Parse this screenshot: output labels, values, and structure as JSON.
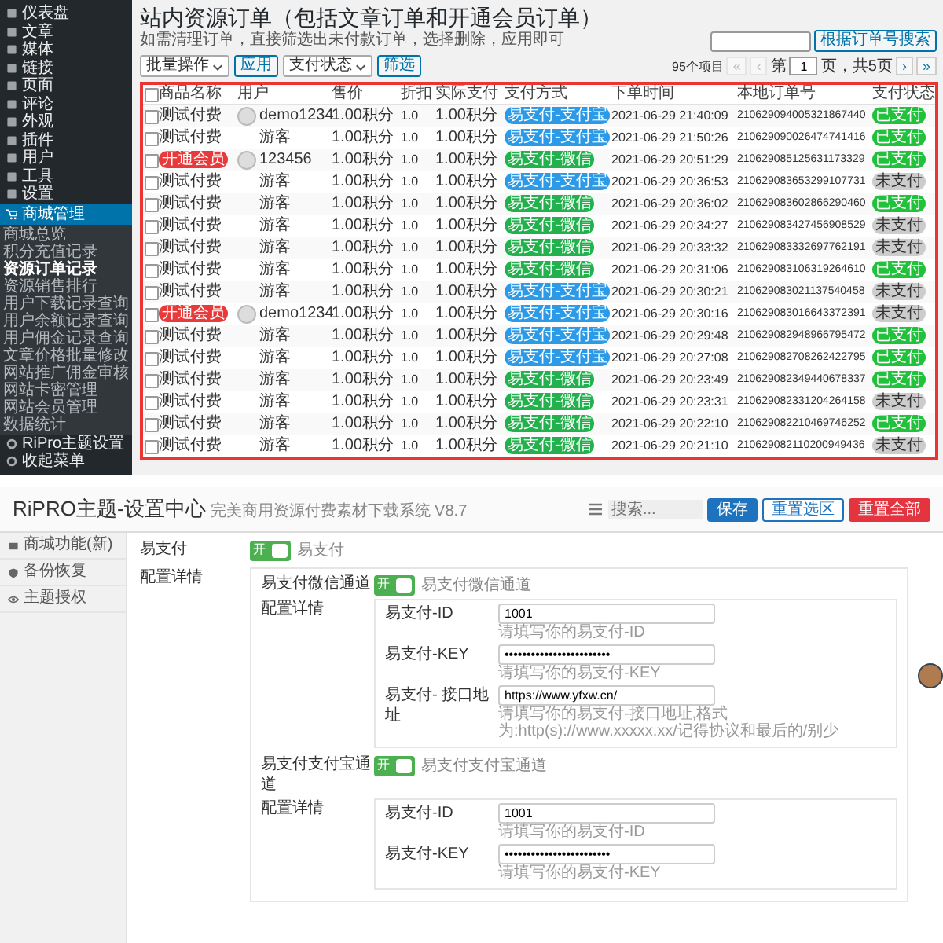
{
  "admin_sidebar": {
    "items": [
      {
        "label": "仪表盘",
        "selected": false
      },
      {
        "label": "文章",
        "selected": false
      },
      {
        "label": "媒体",
        "selected": false
      },
      {
        "label": "链接",
        "selected": false
      },
      {
        "label": "页面",
        "selected": false
      },
      {
        "label": "评论",
        "selected": false
      },
      {
        "label": "外观",
        "selected": false
      },
      {
        "label": "插件",
        "selected": false
      },
      {
        "label": "用户",
        "selected": false
      },
      {
        "label": "工具",
        "selected": false
      },
      {
        "label": "设置",
        "selected": false
      },
      {
        "label": "商城管理",
        "selected": true,
        "children": [
          {
            "label": "商城总览",
            "selected": false
          },
          {
            "label": "积分充值记录",
            "selected": false
          },
          {
            "label": "资源订单记录",
            "selected": true
          },
          {
            "label": "资源销售排行",
            "selected": false
          },
          {
            "label": "用户下载记录查询",
            "selected": false
          },
          {
            "label": "用户余额记录查询",
            "selected": false
          },
          {
            "label": "用户佣金记录查询",
            "selected": false
          },
          {
            "label": "文章价格批量修改",
            "selected": false
          },
          {
            "label": "网站推广佣金审核",
            "selected": false
          },
          {
            "label": "网站卡密管理",
            "selected": false
          },
          {
            "label": "网站会员管理",
            "selected": false
          },
          {
            "label": "数据统计",
            "selected": false
          }
        ]
      },
      {
        "label": "RiPro主题设置",
        "selected": false
      },
      {
        "label": "收起菜单",
        "selected": false
      }
    ]
  },
  "orders_page": {
    "title": "站内资源订单（包括文章订单和开通会员订单）",
    "subtitle": "如需清理订单，直接筛选出未付款订单，选择删除，应用即可",
    "bulk_action": "批量操作",
    "apply_button": "应用",
    "status_filter": "支付状态",
    "filter_button": "筛选",
    "search_button": "根据订单号搜索",
    "pagination": {
      "count": "95个项目",
      "page_prefix": "第",
      "page": "1",
      "page_suffix": "页，共5页",
      "nav": [
        {
          "label": "«",
          "disabled": true
        },
        {
          "label": "‹",
          "disabled": true
        },
        {
          "label": "›",
          "disabled": false
        },
        {
          "label": "»",
          "disabled": false
        }
      ]
    },
    "table": {
      "header_checked": false,
      "columns": [
        "商品名称",
        "用户",
        "售价",
        "折扣",
        "实际支付",
        "支付方式",
        "下单时间",
        "本地订单号",
        "支付状态"
      ],
      "rows": [
        {
          "checked": false,
          "product": {
            "label": "测试付费",
            "kind": "text"
          },
          "user": "demo1234",
          "avatar": true,
          "price": "1.00积分",
          "discount": "1.0",
          "paid": "1.00积分",
          "method": {
            "label": "易支付-支付宝",
            "color": "#2c9ae6"
          },
          "time": "2021-06-29 21:40:09",
          "order_no": "210629094005321867440",
          "status": {
            "label": "已支付",
            "kind": "paid",
            "color": "#22c13c"
          }
        },
        {
          "checked": false,
          "product": {
            "label": "测试付费",
            "kind": "text"
          },
          "user": "游客",
          "avatar": false,
          "price": "1.00积分",
          "discount": "1.0",
          "paid": "1.00积分",
          "method": {
            "label": "易支付-支付宝",
            "color": "#2c9ae6"
          },
          "time": "2021-06-29 21:50:26",
          "order_no": "210629090026474741416",
          "status": {
            "label": "已支付",
            "kind": "paid",
            "color": "#22c13c"
          }
        },
        {
          "checked": false,
          "product": {
            "label": "开通会员",
            "kind": "tag",
            "color": "#e83a3a"
          },
          "user": "123456",
          "avatar": true,
          "price": "1.00积分",
          "discount": "1.0",
          "paid": "1.00积分",
          "method": {
            "label": "易支付-微信",
            "color": "#22b14c"
          },
          "time": "2021-06-29 20:51:29",
          "order_no": "210629085125631173329",
          "status": {
            "label": "已支付",
            "kind": "paid",
            "color": "#22c13c"
          }
        },
        {
          "checked": false,
          "product": {
            "label": "测试付费",
            "kind": "text"
          },
          "user": "游客",
          "avatar": false,
          "price": "1.00积分",
          "discount": "1.0",
          "paid": "1.00积分",
          "method": {
            "label": "易支付-支付宝",
            "color": "#2c9ae6"
          },
          "time": "2021-06-29 20:36:53",
          "order_no": "210629083653299107731",
          "status": {
            "label": "未支付",
            "kind": "unpaid",
            "color": "#cccccc"
          }
        },
        {
          "checked": false,
          "product": {
            "label": "测试付费",
            "kind": "text"
          },
          "user": "游客",
          "avatar": false,
          "price": "1.00积分",
          "discount": "1.0",
          "paid": "1.00积分",
          "method": {
            "label": "易支付-微信",
            "color": "#22b14c"
          },
          "time": "2021-06-29 20:36:02",
          "order_no": "210629083602866290460",
          "status": {
            "label": "已支付",
            "kind": "paid",
            "color": "#22c13c"
          }
        },
        {
          "checked": false,
          "product": {
            "label": "测试付费",
            "kind": "text"
          },
          "user": "游客",
          "avatar": false,
          "price": "1.00积分",
          "discount": "1.0",
          "paid": "1.00积分",
          "method": {
            "label": "易支付-微信",
            "color": "#22b14c"
          },
          "time": "2021-06-29 20:34:27",
          "order_no": "210629083427456908529",
          "status": {
            "label": "未支付",
            "kind": "unpaid",
            "color": "#cccccc"
          }
        },
        {
          "checked": false,
          "product": {
            "label": "测试付费",
            "kind": "text"
          },
          "user": "游客",
          "avatar": false,
          "price": "1.00积分",
          "discount": "1.0",
          "paid": "1.00积分",
          "method": {
            "label": "易支付-微信",
            "color": "#22b14c"
          },
          "time": "2021-06-29 20:33:32",
          "order_no": "210629083332697762191",
          "status": {
            "label": "未支付",
            "kind": "unpaid",
            "color": "#cccccc"
          }
        },
        {
          "checked": false,
          "product": {
            "label": "测试付费",
            "kind": "text"
          },
          "user": "游客",
          "avatar": false,
          "price": "1.00积分",
          "discount": "1.0",
          "paid": "1.00积分",
          "method": {
            "label": "易支付-微信",
            "color": "#22b14c"
          },
          "time": "2021-06-29 20:31:06",
          "order_no": "210629083106319264610",
          "status": {
            "label": "已支付",
            "kind": "paid",
            "color": "#22c13c"
          }
        },
        {
          "checked": false,
          "product": {
            "label": "测试付费",
            "kind": "text"
          },
          "user": "游客",
          "avatar": false,
          "price": "1.00积分",
          "discount": "1.0",
          "paid": "1.00积分",
          "method": {
            "label": "易支付-支付宝",
            "color": "#2c9ae6"
          },
          "time": "2021-06-29 20:30:21",
          "order_no": "210629083021137540458",
          "status": {
            "label": "未支付",
            "kind": "unpaid",
            "color": "#cccccc"
          }
        },
        {
          "checked": false,
          "product": {
            "label": "开通会员",
            "kind": "tag",
            "color": "#e83a3a"
          },
          "user": "demo1234",
          "avatar": true,
          "price": "1.00积分",
          "discount": "1.0",
          "paid": "1.00积分",
          "method": {
            "label": "易支付-支付宝",
            "color": "#2c9ae6"
          },
          "time": "2021-06-29 20:30:16",
          "order_no": "210629083016643372391",
          "status": {
            "label": "未支付",
            "kind": "unpaid",
            "color": "#cccccc"
          }
        },
        {
          "checked": false,
          "product": {
            "label": "测试付费",
            "kind": "text"
          },
          "user": "游客",
          "avatar": false,
          "price": "1.00积分",
          "discount": "1.0",
          "paid": "1.00积分",
          "method": {
            "label": "易支付-支付宝",
            "color": "#2c9ae6"
          },
          "time": "2021-06-29 20:29:48",
          "order_no": "210629082948966795472",
          "status": {
            "label": "已支付",
            "kind": "paid",
            "color": "#22c13c"
          }
        },
        {
          "checked": false,
          "product": {
            "label": "测试付费",
            "kind": "text"
          },
          "user": "游客",
          "avatar": false,
          "price": "1.00积分",
          "discount": "1.0",
          "paid": "1.00积分",
          "method": {
            "label": "易支付-支付宝",
            "color": "#2c9ae6"
          },
          "time": "2021-06-29 20:27:08",
          "order_no": "210629082708262422795",
          "status": {
            "label": "已支付",
            "kind": "paid",
            "color": "#22c13c"
          }
        },
        {
          "checked": false,
          "product": {
            "label": "测试付费",
            "kind": "text"
          },
          "user": "游客",
          "avatar": false,
          "price": "1.00积分",
          "discount": "1.0",
          "paid": "1.00积分",
          "method": {
            "label": "易支付-微信",
            "color": "#22b14c"
          },
          "time": "2021-06-29 20:23:49",
          "order_no": "210629082349440678337",
          "status": {
            "label": "已支付",
            "kind": "paid",
            "color": "#22c13c"
          }
        },
        {
          "checked": false,
          "product": {
            "label": "测试付费",
            "kind": "text"
          },
          "user": "游客",
          "avatar": false,
          "price": "1.00积分",
          "discount": "1.0",
          "paid": "1.00积分",
          "method": {
            "label": "易支付-微信",
            "color": "#22b14c"
          },
          "time": "2021-06-29 20:23:31",
          "order_no": "210629082331204264158",
          "status": {
            "label": "未支付",
            "kind": "unpaid",
            "color": "#cccccc"
          }
        },
        {
          "checked": false,
          "product": {
            "label": "测试付费",
            "kind": "text"
          },
          "user": "游客",
          "avatar": false,
          "price": "1.00积分",
          "discount": "1.0",
          "paid": "1.00积分",
          "method": {
            "label": "易支付-微信",
            "color": "#22b14c"
          },
          "time": "2021-06-29 20:22:10",
          "order_no": "210629082210469746252",
          "status": {
            "label": "已支付",
            "kind": "paid",
            "color": "#22c13c"
          }
        },
        {
          "checked": false,
          "product": {
            "label": "测试付费",
            "kind": "text"
          },
          "user": "游客",
          "avatar": false,
          "price": "1.00积分",
          "discount": "1.0",
          "paid": "1.00积分",
          "method": {
            "label": "易支付-微信",
            "color": "#22b14c"
          },
          "time": "2021-06-29 20:21:10",
          "order_no": "210629082110200949436",
          "status": {
            "label": "未支付",
            "kind": "unpaid",
            "color": "#cccccc"
          }
        }
      ]
    }
  },
  "settings_page": {
    "title": "RiPRO主题-设置中心",
    "subtitle": "完美商用资源付费素材下载系统 V8.7",
    "search_placeholder": "搜索...",
    "buttons": [
      {
        "label": "保存",
        "kind": "primary"
      },
      {
        "label": "重置选区",
        "kind": "outline"
      },
      {
        "label": "重置全部",
        "kind": "danger"
      }
    ],
    "sidebar": [
      {
        "label": "商城功能(新)",
        "selected": false
      },
      {
        "label": "备份恢复",
        "selected": false
      },
      {
        "label": "主题授权",
        "selected": false
      }
    ],
    "fields": [
      {
        "kind": "switch",
        "label": "易支付",
        "on": true,
        "switch_text": "开",
        "description": "易支付"
      },
      {
        "kind": "group",
        "label": "配置详情",
        "children": [
          {
            "kind": "switch",
            "label": "易支付微信通道",
            "on": true,
            "switch_text": "开",
            "description": "易支付微信通道"
          },
          {
            "kind": "group",
            "label": "配置详情",
            "children": [
              {
                "kind": "text",
                "label": "易支付-ID",
                "value": "1001",
                "hint": "请填写你的易支付-ID"
              },
              {
                "kind": "text",
                "label": "易支付-KEY",
                "value": "••••••••••••••••••••••••",
                "hint": "请填写你的易支付-KEY"
              },
              {
                "kind": "text",
                "label": "易支付- 接口地址",
                "value": "https://www.yfxw.cn/",
                "hint": "请填写你的易支付-接口地址,格式为:http(s)://www.xxxxx.xx/记得协议和最后的/别少"
              }
            ]
          },
          {
            "kind": "switch",
            "label": "易支付支付宝通道",
            "on": true,
            "switch_text": "开",
            "description": "易支付支付宝通道"
          },
          {
            "kind": "group",
            "label": "配置详情",
            "children": [
              {
                "kind": "text",
                "label": "易支付-ID",
                "value": "1001",
                "hint": "请填写你的易支付-ID"
              },
              {
                "kind": "text",
                "label": "易支付-KEY",
                "value": "••••••••••••••••••••••••",
                "hint": "请填写你的易支付-KEY"
              }
            ]
          }
        ]
      }
    ]
  }
}
